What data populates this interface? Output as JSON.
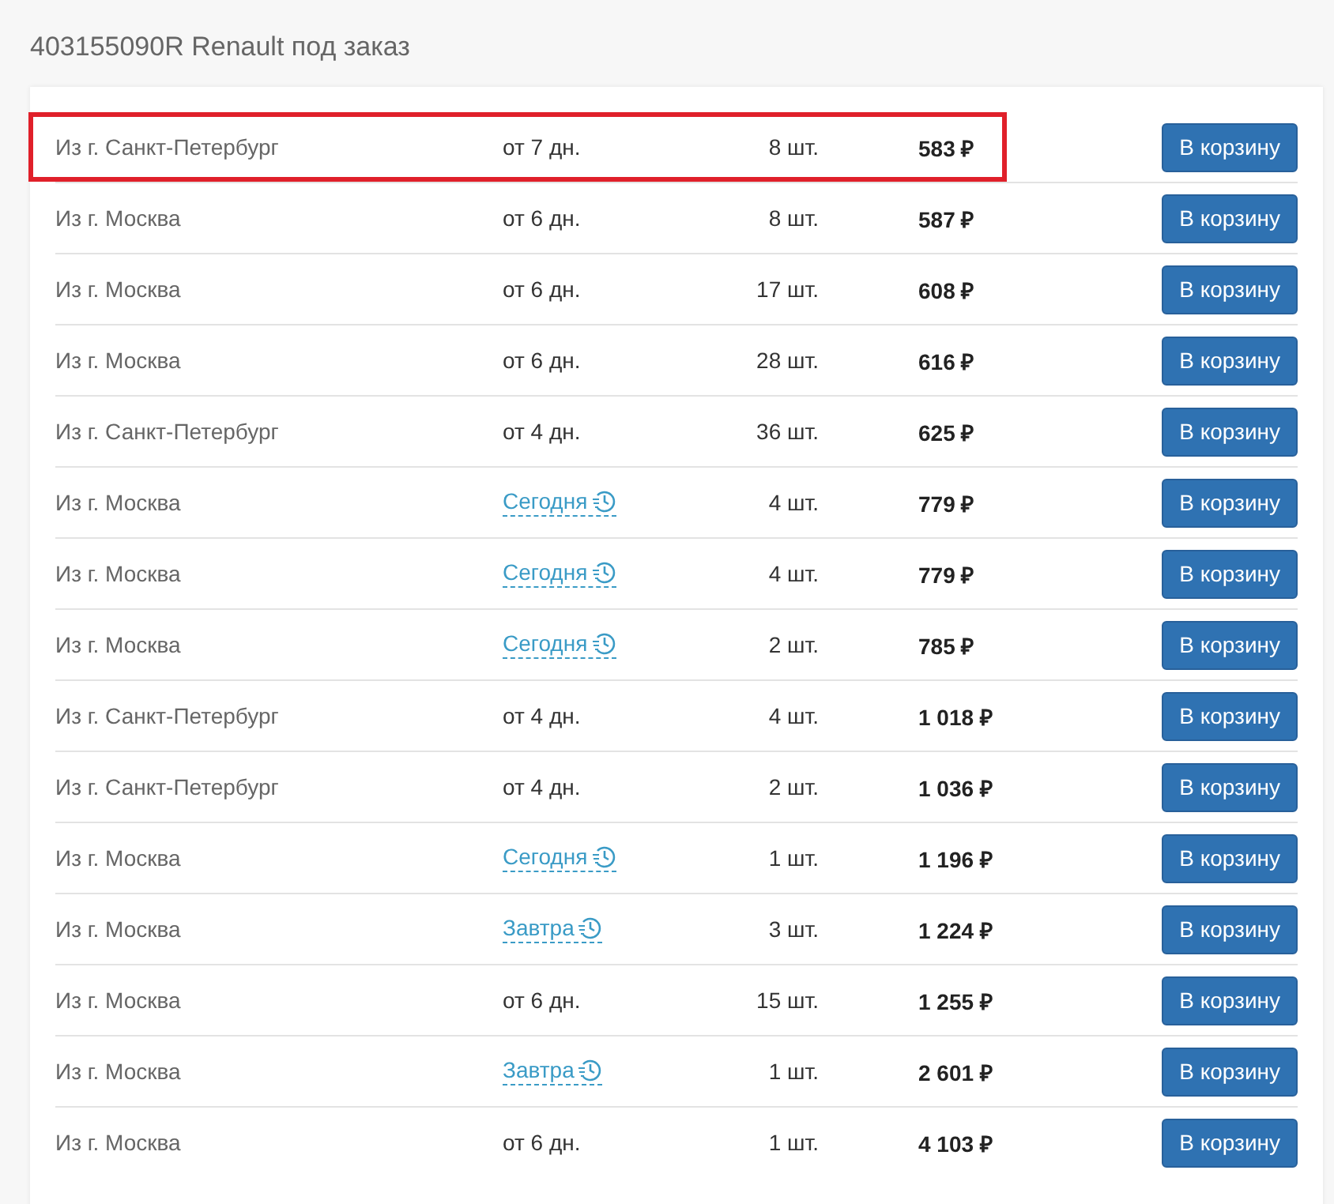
{
  "title": "403155090R Renault под заказ",
  "rows": [
    {
      "origin": "Из г. Санкт-Петербург",
      "delivery": {
        "kind": "days",
        "text": "от 7 дн."
      },
      "quantity": "8 шт.",
      "price": "583 ₽",
      "button": "В корзину",
      "highlighted": true
    },
    {
      "origin": "Из г. Москва",
      "delivery": {
        "kind": "days",
        "text": "от 6 дн."
      },
      "quantity": "8 шт.",
      "price": "587 ₽",
      "button": "В корзину",
      "highlighted": false
    },
    {
      "origin": "Из г. Москва",
      "delivery": {
        "kind": "days",
        "text": "от 6 дн."
      },
      "quantity": "17 шт.",
      "price": "608 ₽",
      "button": "В корзину",
      "highlighted": false
    },
    {
      "origin": "Из г. Москва",
      "delivery": {
        "kind": "days",
        "text": "от 6 дн."
      },
      "quantity": "28 шт.",
      "price": "616 ₽",
      "button": "В корзину",
      "highlighted": false
    },
    {
      "origin": "Из г. Санкт-Петербург",
      "delivery": {
        "kind": "days",
        "text": "от 4 дн."
      },
      "quantity": "36 шт.",
      "price": "625 ₽",
      "button": "В корзину",
      "highlighted": false
    },
    {
      "origin": "Из г. Москва",
      "delivery": {
        "kind": "link",
        "text": "Сегодня"
      },
      "quantity": "4 шт.",
      "price": "779 ₽",
      "button": "В корзину",
      "highlighted": false
    },
    {
      "origin": "Из г. Москва",
      "delivery": {
        "kind": "link",
        "text": "Сегодня"
      },
      "quantity": "4 шт.",
      "price": "779 ₽",
      "button": "В корзину",
      "highlighted": false
    },
    {
      "origin": "Из г. Москва",
      "delivery": {
        "kind": "link",
        "text": "Сегодня"
      },
      "quantity": "2 шт.",
      "price": "785 ₽",
      "button": "В корзину",
      "highlighted": false
    },
    {
      "origin": "Из г. Санкт-Петербург",
      "delivery": {
        "kind": "days",
        "text": "от 4 дн."
      },
      "quantity": "4 шт.",
      "price": "1 018 ₽",
      "button": "В корзину",
      "highlighted": false
    },
    {
      "origin": "Из г. Санкт-Петербург",
      "delivery": {
        "kind": "days",
        "text": "от 4 дн."
      },
      "quantity": "2 шт.",
      "price": "1 036 ₽",
      "button": "В корзину",
      "highlighted": false
    },
    {
      "origin": "Из г. Москва",
      "delivery": {
        "kind": "link",
        "text": "Сегодня"
      },
      "quantity": "1 шт.",
      "price": "1 196 ₽",
      "button": "В корзину",
      "highlighted": false
    },
    {
      "origin": "Из г. Москва",
      "delivery": {
        "kind": "link",
        "text": "Завтра"
      },
      "quantity": "3 шт.",
      "price": "1 224 ₽",
      "button": "В корзину",
      "highlighted": false
    },
    {
      "origin": "Из г. Москва",
      "delivery": {
        "kind": "days",
        "text": "от 6 дн."
      },
      "quantity": "15 шт.",
      "price": "1 255 ₽",
      "button": "В корзину",
      "highlighted": false
    },
    {
      "origin": "Из г. Москва",
      "delivery": {
        "kind": "link",
        "text": "Завтра"
      },
      "quantity": "1 шт.",
      "price": "2 601 ₽",
      "button": "В корзину",
      "highlighted": false
    },
    {
      "origin": "Из г. Москва",
      "delivery": {
        "kind": "days",
        "text": "от 6 дн."
      },
      "quantity": "1 шт.",
      "price": "4 103 ₽",
      "button": "В корзину",
      "highlighted": false
    }
  ]
}
